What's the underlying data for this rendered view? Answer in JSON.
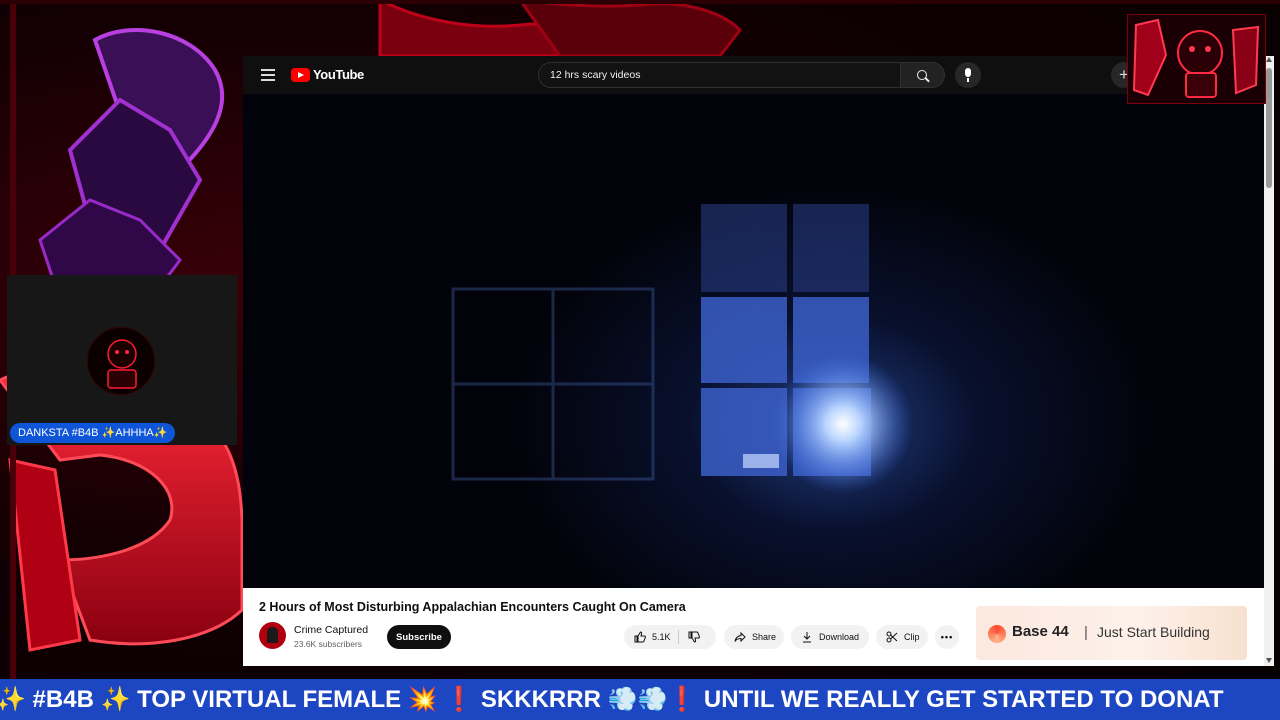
{
  "youtube": {
    "logo_text": "YouTube",
    "search": {
      "value": "12 hrs scary videos"
    },
    "video": {
      "title": "2 Hours of Most Disturbing Appalachian Encounters Caught On Camera",
      "channel_name": "Crime Captured",
      "subscribers": "23.6K subscribers",
      "subscribe_label": "Subscribe",
      "like_count": "5.1K",
      "share_label": "Share",
      "download_label": "Download",
      "clip_label": "Clip",
      "more_label": "•••"
    },
    "ad": {
      "brand": "Base 44",
      "separator": "|",
      "tagline": "Just Start Building"
    },
    "icons": [
      "menu-icon",
      "youtube-logo-icon",
      "search-icon",
      "mic-icon",
      "create-icon",
      "like-icon",
      "dislike-icon",
      "share-icon",
      "download-icon",
      "clip-icon"
    ]
  },
  "overlay": {
    "cam_name": "DANKSTA #B4B ✨AHHHA✨",
    "ticker": "✨ #B4B ✨ TOP VIRTUAL FEMALE 💥 ❗ SKKKRRR 💨💨❗ UNTIL WE REALLY GET STARTED TO DONAT",
    "colors": {
      "ticker_bg": "#1d46c2",
      "cam_label_bg": "#0f55d8",
      "accent_red": "#d8001c"
    }
  }
}
